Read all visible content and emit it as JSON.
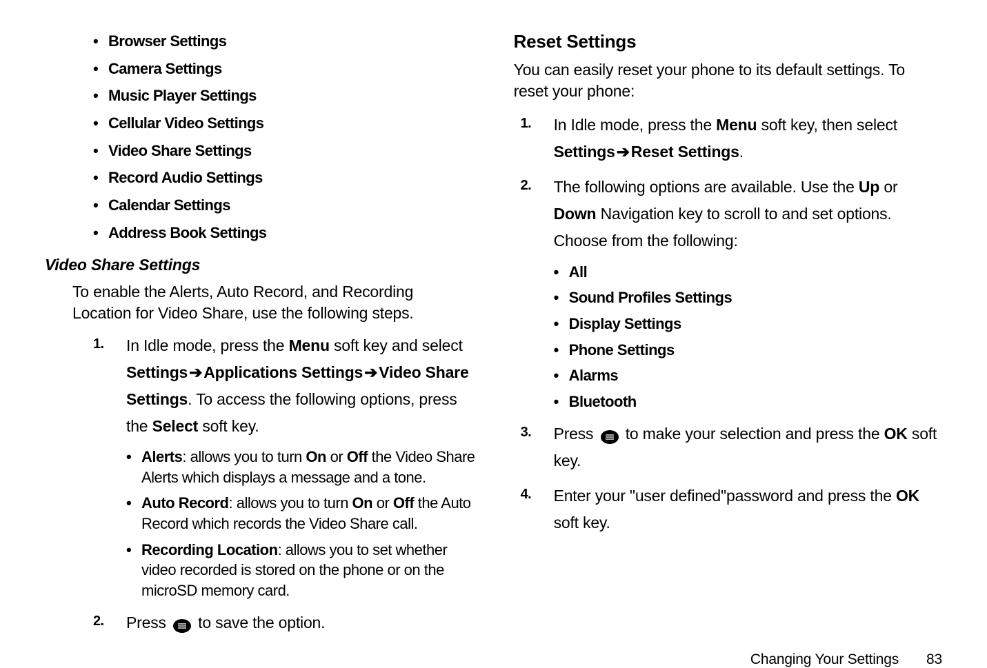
{
  "left": {
    "top_bullets": [
      "Browser Settings",
      "Camera Settings",
      "Music Player Settings",
      "Cellular Video Settings",
      "Video Share Settings",
      "Record Audio Settings",
      "Calendar Settings",
      "Address Book Settings"
    ],
    "h3": "Video Share Settings",
    "intro": "To enable the Alerts, Auto Record, and Recording Location for Video Share, use the following steps.",
    "step1": {
      "pre": "In Idle mode, press the ",
      "k1": "Menu",
      "mid1": " soft key and select ",
      "k2": "Settings",
      "arr1": " ➔ ",
      "k3": "Applications Settings",
      "arr2": " ➔ ",
      "k4": "Video Share Settings",
      "mid2": ". To access the following options, press the ",
      "k5": "Select",
      "post": " soft key.",
      "sub": [
        {
          "title": "Alerts",
          "body": ": allows you to turn ",
          "k1": "On",
          "mid": " or ",
          "k2": "Off",
          "rest": " the Video Share Alerts which displays a message and a tone."
        },
        {
          "title": "Auto Record",
          "body": ": allows you to turn ",
          "k1": "On",
          "mid": " or ",
          "k2": "Off",
          "rest": " the Auto Record which records the Video Share call."
        },
        {
          "title": "Recording Location",
          "body": ": allows you to set whether video recorded is stored on the phone or on the microSD memory card.",
          "k1": "",
          "mid": "",
          "k2": "",
          "rest": ""
        }
      ]
    },
    "step2": {
      "pre": "Press ",
      "post": " to save the option."
    }
  },
  "right": {
    "h2": "Reset Settings",
    "intro": "You can easily reset your phone to its default settings. To reset your phone:",
    "step1": {
      "pre": "In Idle mode, press the ",
      "k1": "Menu",
      "mid": " soft key, then select ",
      "k2": "Settings",
      "arr": " ➔ ",
      "k3": "Reset Settings",
      "post": "."
    },
    "step2": {
      "pre": "The following options are available. Use the ",
      "k1": "Up",
      "mid": " or ",
      "k2": "Down",
      "post": " Navigation key to scroll to and set options. Choose from the following:",
      "bullets": [
        "All",
        "Sound Profiles Settings",
        "Display Settings",
        "Phone Settings",
        "Alarms",
        "Bluetooth"
      ]
    },
    "step3": {
      "pre": "Press ",
      "mid": " to make your selection and press the ",
      "k1": "OK",
      "post": " soft key."
    },
    "step4": {
      "pre": "Enter your \"user defined\"password and press the ",
      "k1": "OK",
      "post": " soft key."
    }
  },
  "footer": {
    "title": "Changing Your Settings",
    "page": "83"
  }
}
